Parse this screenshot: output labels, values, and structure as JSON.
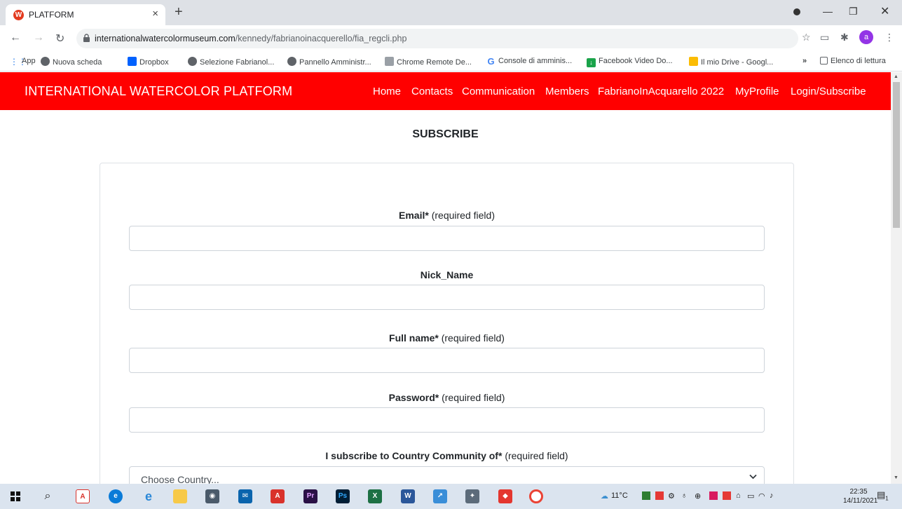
{
  "browser": {
    "tab_title": "PLATFORM",
    "tab_favicon": "W",
    "url_host": "internationalwatercolormuseum.com",
    "url_path": "/kennedy/fabrianoinacquerello/fia_regcli.php",
    "profile_initial": "a"
  },
  "bookmarks": {
    "items": [
      "App",
      "Nuova scheda",
      "Dropbox",
      "Selezione Fabrianol...",
      "Pannello Amministr...",
      "Chrome Remote De...",
      "Console di amminis...",
      "Facebook Video Do...",
      "Il mio Drive - Googl..."
    ],
    "overflow": "»",
    "reading_list": "Elenco di lettura"
  },
  "site": {
    "brand": "INTERNATIONAL WATERCOLOR PLATFORM",
    "nav": [
      "Home",
      "Contacts",
      "Communication",
      "Members",
      "FabrianoInAcquarello 2022",
      "MyProfile",
      "Login/Subscribe"
    ],
    "brand_color": "#ff0000"
  },
  "form": {
    "title": "SUBSCRIBE",
    "email_label": "Email*",
    "email_note": "(required field)",
    "nick_label": "Nick_Name",
    "fullname_label": "Full name*",
    "fullname_note": "(required field)",
    "password_label": "Password*",
    "password_note": "(required field)",
    "country_label": "I subscribe to Country Community of*",
    "country_note": "(required field)",
    "country_value": "Choose Country..."
  },
  "taskbar": {
    "temperature": "11°C",
    "time": "22:35",
    "date": "14/11/2021",
    "notification_count": "1"
  }
}
